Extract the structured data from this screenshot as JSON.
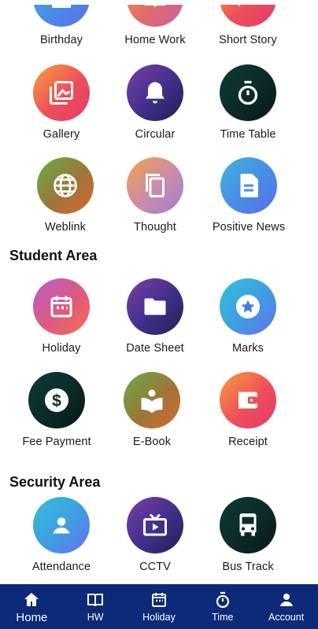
{
  "sections": {
    "student_area": "Student Area",
    "security_area": "Security Area"
  },
  "tiles": {
    "birthday": "Birthday",
    "home_work": "Home Work",
    "short_story": "Short Story",
    "gallery": "Gallery",
    "circular": "Circular",
    "time_table": "Time Table",
    "weblink": "Weblink",
    "thought": "Thought",
    "positive_news": "Positive News",
    "holiday": "Holiday",
    "date_sheet": "Date Sheet",
    "marks": "Marks",
    "fee_payment": "Fee Payment",
    "e_book": "E-Book",
    "receipt": "Receipt",
    "attendance": "Attendance",
    "cctv": "CCTV",
    "bus_track": "Bus Track"
  },
  "nav": {
    "home": "Home",
    "hw": "HW",
    "holiday": "Holiday",
    "time": "Time",
    "account": "Account",
    "active": "home"
  },
  "colors": {
    "nav_background": "#0d2a78",
    "text": "#111111"
  }
}
